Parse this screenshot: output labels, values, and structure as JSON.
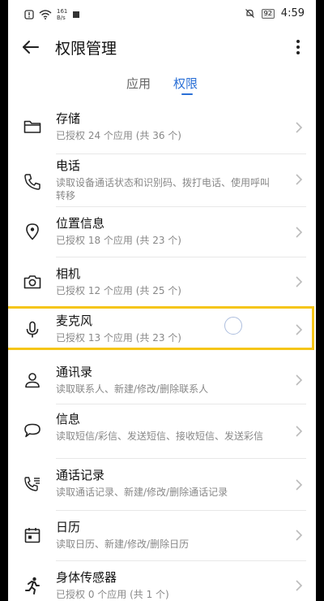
{
  "status_bar": {
    "net_speed_top": "161",
    "net_speed_bottom": "B/s",
    "battery": "92",
    "time": "4:59"
  },
  "app_bar": {
    "title": "权限管理",
    "back_icon": "arrow-left-icon",
    "more_icon": "more-vertical-icon"
  },
  "tabs": [
    {
      "label": "应用",
      "selected": false
    },
    {
      "label": "权限",
      "selected": true
    }
  ],
  "accent_color": "#2a6fd6",
  "highlight_color": "#f5c518",
  "permissions": [
    {
      "title": "存储",
      "subtitle": "已授权 24 个应用 (共 36 个)",
      "icon": "folder-icon"
    },
    {
      "title": "电话",
      "subtitle": "读取设备通话状态和识别码、拨打电话、使用呼叫转移",
      "icon": "phone-icon"
    },
    {
      "title": "位置信息",
      "subtitle": "已授权 18 个应用 (共 23 个)",
      "icon": "location-pin-icon"
    },
    {
      "title": "相机",
      "subtitle": "已授权 12 个应用 (共 25 个)",
      "icon": "camera-icon"
    },
    {
      "title": "麦克风",
      "subtitle": "已授权 13 个应用 (共 23 个)",
      "icon": "microphone-icon"
    },
    {
      "title": "通讯录",
      "subtitle": "读取联系人、新建/修改/删除联系人",
      "icon": "contact-person-icon"
    },
    {
      "title": "信息",
      "subtitle": "读取短信/彩信、发送短信、接收短信、发送彩信",
      "icon": "message-bubble-icon"
    },
    {
      "title": "通话记录",
      "subtitle": "读取通话记录、新建/修改/删除通话记录",
      "icon": "call-log-icon"
    },
    {
      "title": "日历",
      "subtitle": "读取日历、新建/修改/删除日历",
      "icon": "calendar-icon"
    },
    {
      "title": "身体传感器",
      "subtitle": "已授权 0 个应用 (共 1 个)",
      "icon": "running-person-icon"
    }
  ]
}
